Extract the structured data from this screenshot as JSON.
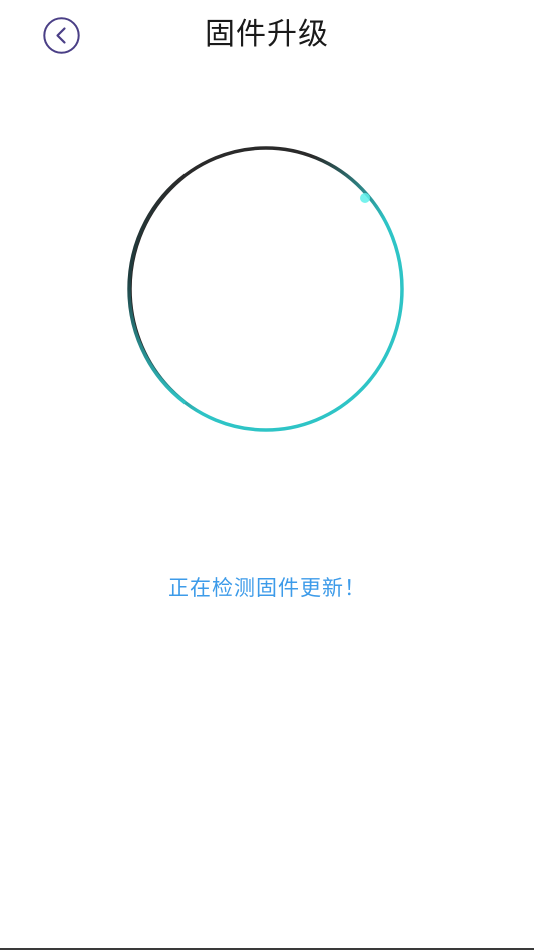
{
  "header": {
    "back_icon": "chevron-left-circle-icon",
    "title": "固件升级"
  },
  "progress": {
    "state": "checking",
    "colors": {
      "track_dark": "#2a2a2a",
      "accent": "#2ec4c6",
      "accent_light": "#5ff0ea"
    }
  },
  "status": {
    "text": "正在检测固件更新！",
    "color": "#3d9be9"
  },
  "theme": {
    "back_icon_color": "#4a3f86",
    "title_color": "#1a1a1a",
    "background": "#ffffff"
  }
}
